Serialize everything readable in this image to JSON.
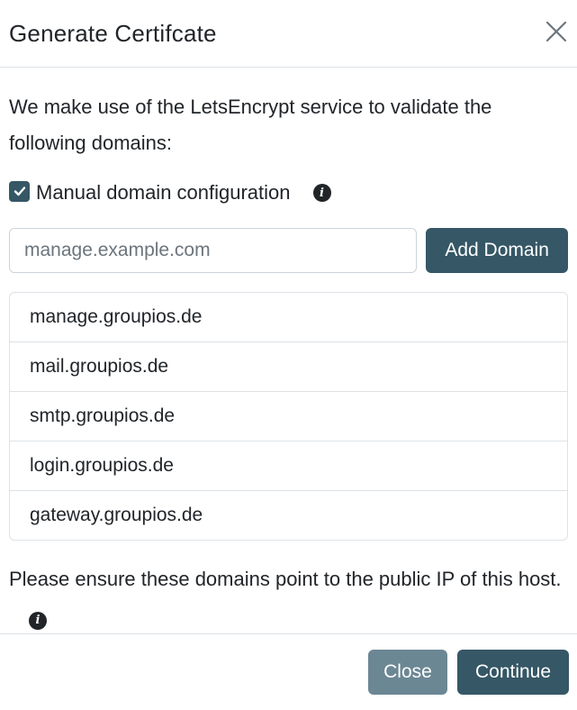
{
  "dialog": {
    "title": "Generate Certifcate",
    "close_icon": "close-icon"
  },
  "body": {
    "intro_text": "We make use of the LetsEncrypt service to validate the following domains:",
    "manual_checkbox": {
      "label": "Manual domain configuration",
      "checked": true,
      "info_icon": "info-icon"
    },
    "domain_input": {
      "placeholder": "manage.example.com",
      "value": ""
    },
    "add_button_label": "Add Domain",
    "domains": [
      "manage.groupios.de",
      "mail.groupios.de",
      "smtp.groupios.de",
      "login.groupios.de",
      "gateway.groupios.de"
    ],
    "note_text": "Please ensure these domains point to the public IP of this host."
  },
  "footer": {
    "close_label": "Close",
    "continue_label": "Continue"
  },
  "colors": {
    "primary": "#355766",
    "secondary": "#6c8794",
    "text": "#212529",
    "border": "#dee2e6"
  }
}
